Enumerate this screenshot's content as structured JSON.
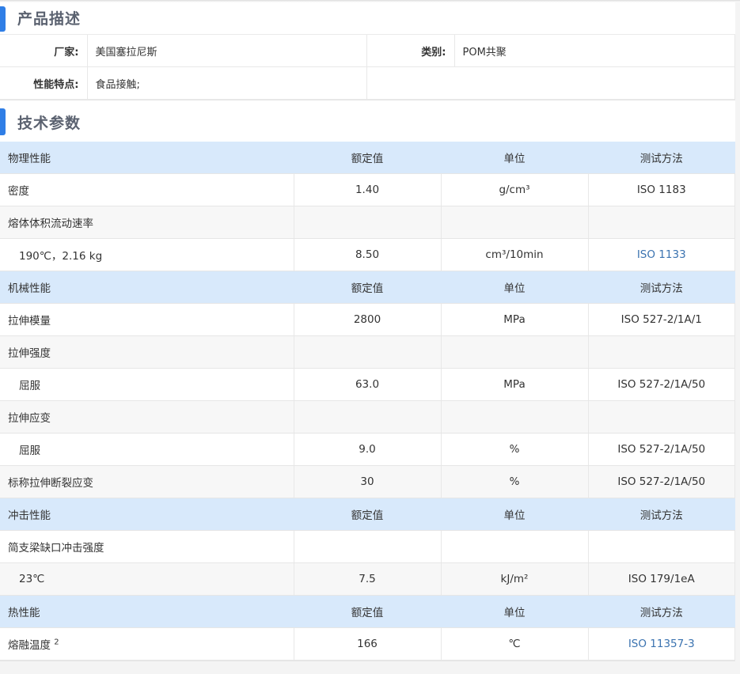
{
  "sections": {
    "description_title": "产品描述",
    "tech_title": "技术参数"
  },
  "description": {
    "manufacturer_label": "厂家:",
    "manufacturer_value": "美国塞拉尼斯",
    "category_label": "类别:",
    "category_value": "POM共聚",
    "features_label": "性能特点:",
    "features_value": "食品接触;"
  },
  "table": {
    "rows": [
      {
        "type": "hdr",
        "c0": "物理性能",
        "c1": "额定值",
        "c2": "单位",
        "c3": "测试方法"
      },
      {
        "type": "odd",
        "c0": "密度",
        "c1": "1.40",
        "c2": "g/cm³",
        "c3": "ISO 1183"
      },
      {
        "type": "even",
        "c0": "熔体体积流动速率",
        "c1": "",
        "c2": "",
        "c3": ""
      },
      {
        "type": "odd",
        "sub": true,
        "c0": "190℃，2.16 kg",
        "c1": "8.50",
        "c2": "cm³/10min",
        "c3": "ISO 1133",
        "link": true
      },
      {
        "type": "hdr",
        "c0": "机械性能",
        "c1": "额定值",
        "c2": "单位",
        "c3": "测试方法"
      },
      {
        "type": "odd",
        "c0": "拉伸模量",
        "c1": "2800",
        "c2": "MPa",
        "c3": "ISO 527-2/1A/1"
      },
      {
        "type": "even",
        "c0": "拉伸强度",
        "c1": "",
        "c2": "",
        "c3": ""
      },
      {
        "type": "odd",
        "sub": true,
        "c0": "屈服",
        "c1": "63.0",
        "c2": "MPa",
        "c3": "ISO 527-2/1A/50"
      },
      {
        "type": "even",
        "c0": "拉伸应变",
        "c1": "",
        "c2": "",
        "c3": ""
      },
      {
        "type": "odd",
        "sub": true,
        "c0": "屈服",
        "c1": "9.0",
        "c2": "%",
        "c3": "ISO 527-2/1A/50"
      },
      {
        "type": "even",
        "c0": "标称拉伸断裂应变",
        "c1": "30",
        "c2": "%",
        "c3": "ISO 527-2/1A/50"
      },
      {
        "type": "hdr",
        "c0": "冲击性能",
        "c1": "额定值",
        "c2": "单位",
        "c3": "测试方法"
      },
      {
        "type": "odd",
        "c0": "简支梁缺口冲击强度",
        "c1": "",
        "c2": "",
        "c3": ""
      },
      {
        "type": "even",
        "sub": true,
        "c0": "23℃",
        "c1": "7.5",
        "c2": "kJ/m²",
        "c3": "ISO 179/1eA"
      },
      {
        "type": "hdr",
        "c0": "热性能",
        "c1": "额定值",
        "c2": "单位",
        "c3": "测试方法"
      },
      {
        "type": "odd",
        "c0": "熔融温度",
        "sup": "2",
        "c1": "166",
        "c2": "℃",
        "c3": "ISO 11357-3",
        "link": true
      }
    ]
  }
}
